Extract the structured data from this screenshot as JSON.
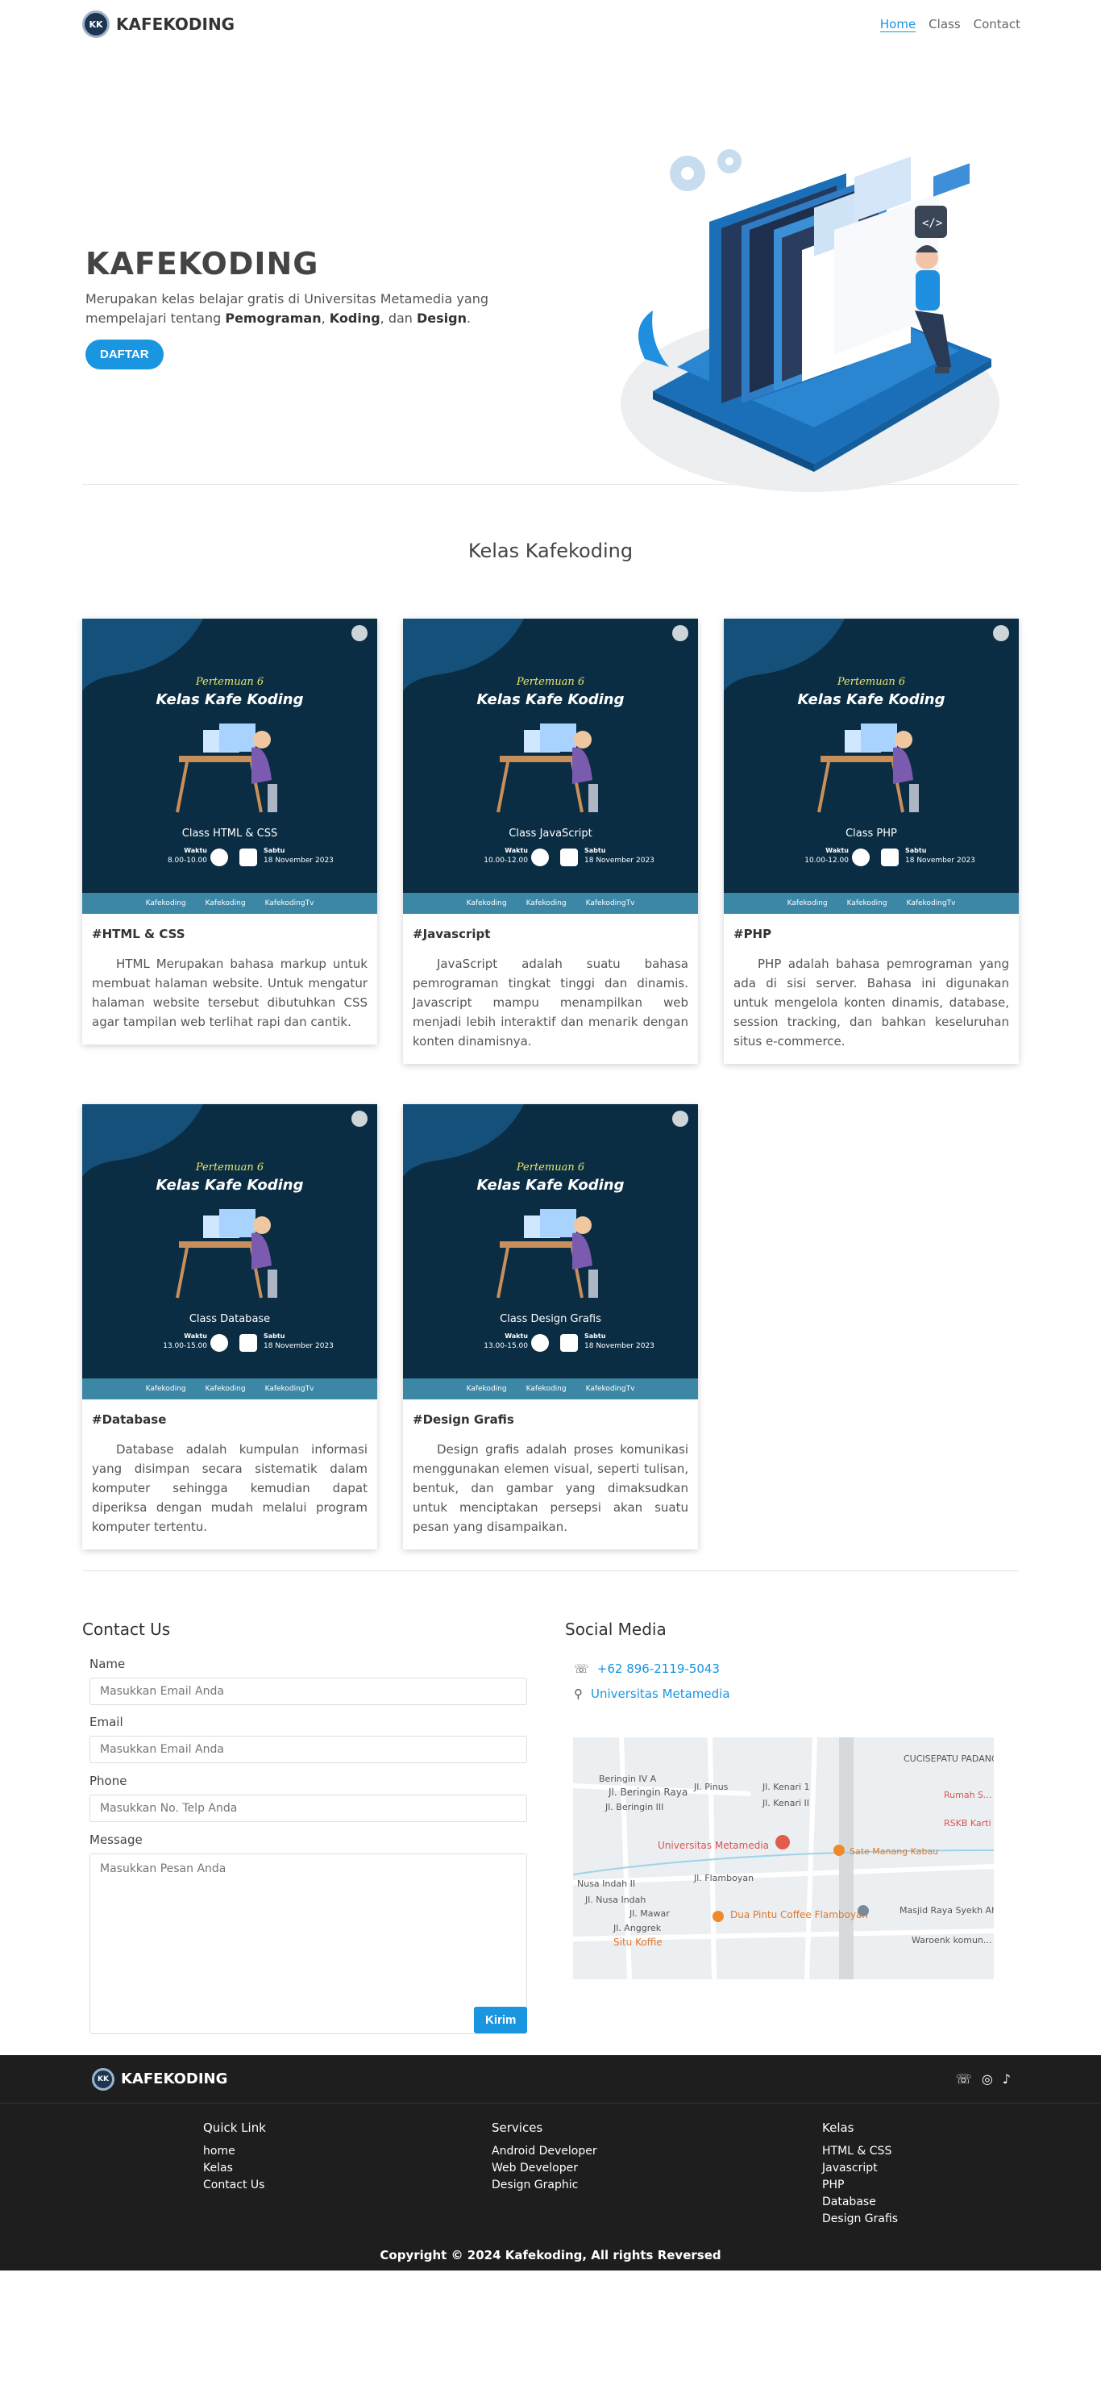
{
  "nav": {
    "brand": "KAFEKODING",
    "logo_text": "KK",
    "items": [
      {
        "label": "Home"
      },
      {
        "label": "Class"
      },
      {
        "label": "Contact"
      }
    ]
  },
  "hero": {
    "title": "KAFEKODING",
    "desc_part1": "Merupakan kelas belajar gratis di Universitas Metamedia yang mempelajari tentang ",
    "desc_bold1": "Pemograman",
    "desc_sep1": ", ",
    "desc_bold2": "Koding",
    "desc_sep2": ", dan ",
    "desc_bold3": "Design",
    "desc_end": ".",
    "button": "DAFTAR"
  },
  "kelas": {
    "title": "Kelas Kafekoding",
    "poster": {
      "meeting": "Pertemuan 6",
      "heading": "Kelas Kafe Koding",
      "time_label": "Waktu",
      "day_label": "Sabtu",
      "date": "18 November 2023",
      "social1": "Kafekoding",
      "social2": "Kafekoding",
      "social3": "KafekodingTv"
    },
    "cards": [
      {
        "class_name": "Class HTML & CSS",
        "time": "8.00-10.00",
        "title": "#HTML & CSS",
        "text": "HTML Merupakan bahasa markup untuk membuat halaman website. Untuk mengatur halaman website tersebut dibutuhkan CSS agar tampilan web terlihat rapi dan cantik."
      },
      {
        "class_name": "Class JavaScript",
        "time": "10.00-12.00",
        "title": "#Javascript",
        "text": "JavaScript adalah suatu bahasa pemrograman tingkat tinggi dan dinamis. Javascript mampu menampilkan web menjadi lebih interaktif dan menarik dengan konten dinamisnya."
      },
      {
        "class_name": "Class PHP",
        "time": "10.00-12.00",
        "title": "#PHP",
        "text": "PHP adalah bahasa pemrograman yang ada di sisi server. Bahasa ini digunakan untuk mengelola konten dinamis, database, session tracking, dan bahkan keseluruhan situs e-commerce."
      },
      {
        "class_name": "Class Database",
        "time": "13.00-15.00",
        "title": "#Database",
        "text": "Database adalah kumpulan informasi yang disimpan secara sistematik dalam komputer sehingga kemudian dapat diperiksa dengan mudah melalui program komputer tertentu."
      },
      {
        "class_name": "Class Design Grafis",
        "time": "13.00-15.00",
        "title": "#Design Grafis",
        "text": "Design grafis adalah proses komunikasi menggunakan elemen visual, seperti tulisan, bentuk, dan gambar yang dimaksudkan untuk menciptakan persepsi akan suatu pesan yang disampaikan."
      }
    ]
  },
  "contact": {
    "title": "Contact Us",
    "name_label": "Name",
    "name_placeholder": "Masukkan Email Anda",
    "email_label": "Email",
    "email_placeholder": "Masukkan Email Anda",
    "phone_label": "Phone",
    "phone_placeholder": "Masukkan No. Telp Anda",
    "message_label": "Message",
    "message_placeholder": "Masukkan Pesan Anda",
    "button": "Kirim"
  },
  "social": {
    "title": "Social Media",
    "phone": "+62 896-2119-5043",
    "location": "Universitas Metamedia",
    "map_labels": {
      "l1": "Beringin IV A",
      "l2": "Jl. Beringin Raya",
      "l3": "Jl. Beringin III",
      "l4": "Jl. Pinus",
      "l5": "Jl. Kenari 1",
      "l6": "Jl. Kenari II",
      "l7": "Universitas Metamedia",
      "l8": "Sate Manang Kabau",
      "l9": "Nusa Indah II",
      "l10": "Jl. Nusa Indah",
      "l11": "Jl. Flamboyan",
      "l12": "Dua Pintu Coffee Flamboyan",
      "l13": "Jl. Mawar",
      "l14": "Jl. Anggrek",
      "l15": "Situ Koffie",
      "l16": "Masjid Raya Syekh Ahmad Khatib Al...",
      "l17": "CUCISEPATU PADANG STORE",
      "l18": "RSKB Karti",
      "l19": "Rumah S... Ibnu Sin...",
      "l20": "Waroenk komun... express al..."
    }
  },
  "footer": {
    "brand": "KAFEKODING",
    "quick_title": "Quick Link",
    "quick": [
      "home",
      "Kelas",
      "Contact Us"
    ],
    "services_title": "Services",
    "services": [
      "Android Developer",
      "Web Developer",
      "Design Graphic"
    ],
    "kelas_title": "Kelas",
    "kelas": [
      "HTML & CSS",
      "Javascript",
      "PHP",
      "Database",
      "Design Grafis"
    ],
    "copyright": "Copyright © 2024 Kafekoding, All rights Reversed"
  },
  "colors": {
    "accent": "#1a95e0",
    "poster_bg": "#0b2d44",
    "poster_strip": "#3d87a6",
    "footer_bg": "#1e1e1e"
  }
}
